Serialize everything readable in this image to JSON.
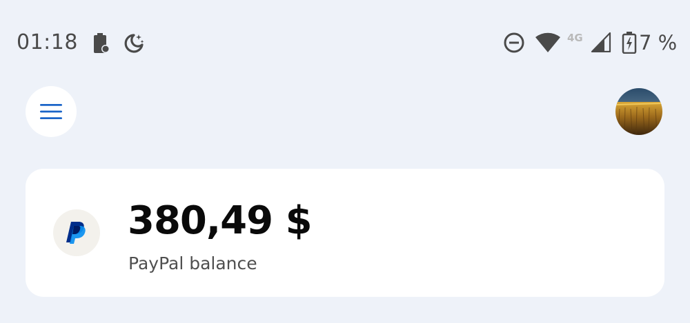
{
  "status_bar": {
    "time": "01:18",
    "left_icons": [
      "battery-alert-icon",
      "night-mode-icon"
    ],
    "right_icons": [
      "do-not-disturb-icon",
      "wifi-icon",
      "cellular-signal-icon",
      "battery-charging-icon"
    ],
    "network_type": "4G",
    "battery_percent": "7 %"
  },
  "header": {
    "menu_icon": "hamburger-menu-icon",
    "avatar_icon": "profile-avatar"
  },
  "balance_card": {
    "logo_icon": "paypal-logo-icon",
    "amount": "380,49 $",
    "label": "PayPal balance"
  },
  "colors": {
    "background": "#eef2f9",
    "card": "#ffffff",
    "accent_blue": "#1a64c8",
    "paypal_dark_blue": "#002e8a",
    "paypal_light_blue": "#0a8ff0"
  }
}
